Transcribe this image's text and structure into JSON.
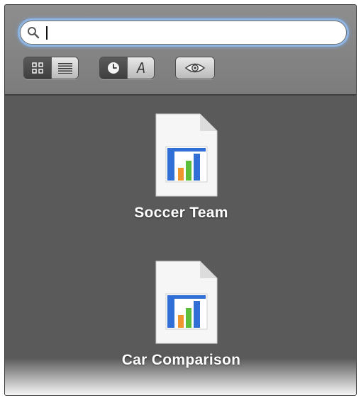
{
  "search": {
    "value": "",
    "placeholder": ""
  },
  "view_modes": [
    {
      "name": "icon-view",
      "icon": "grid-icon",
      "selected": true
    },
    {
      "name": "list-view",
      "icon": "list-icon",
      "selected": false
    }
  ],
  "sort_modes": [
    {
      "name": "sort-by-date",
      "icon": "clock-icon",
      "selected": true
    },
    {
      "name": "sort-by-name",
      "icon": "letter-a-icon",
      "selected": false
    }
  ],
  "quicklook": {
    "icon": "eye-icon"
  },
  "documents": [
    {
      "label": "Soccer Team",
      "icon": "chart-document-icon"
    },
    {
      "label": "Car Comparison",
      "icon": "chart-document-icon"
    }
  ],
  "colors": {
    "panel": "#5a5a5a",
    "toolbar": "#858585",
    "focus_ring": "#8fb5e3",
    "bar_blue": "#2f6fd6",
    "bar_green": "#5cbf3c",
    "bar_orange": "#f0962e"
  }
}
